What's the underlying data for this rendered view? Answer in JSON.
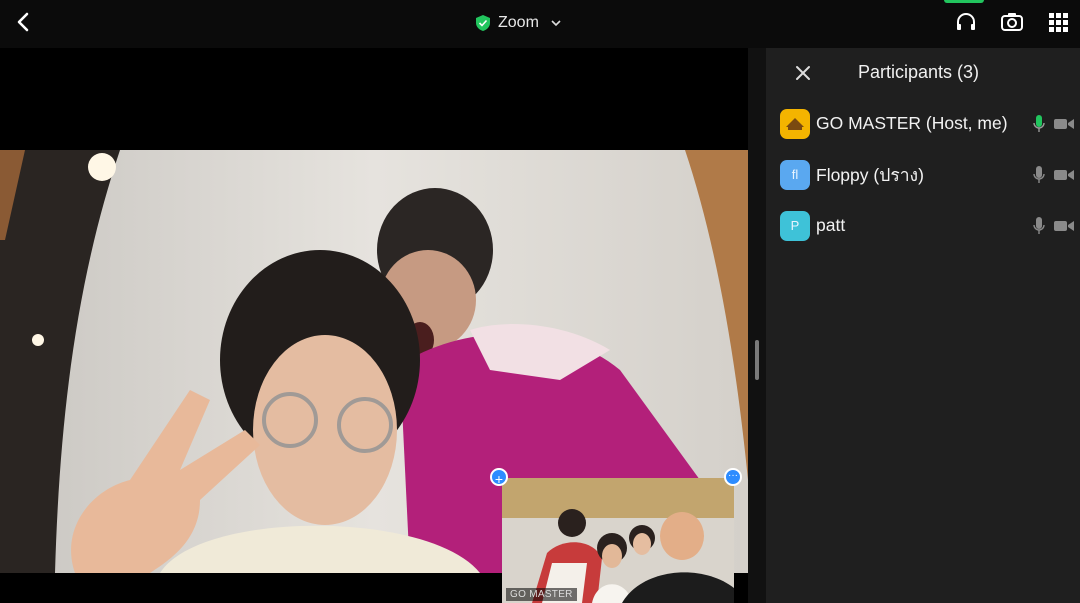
{
  "header": {
    "title": "Zoom",
    "back_icon": "chevron-left-icon",
    "icons": [
      "headphones-icon",
      "camera-switch-icon",
      "grid-icon"
    ]
  },
  "pip": {
    "name": "GO MASTER"
  },
  "participants": {
    "title": "Participants (3)",
    "items": [
      {
        "name": "GO MASTER (Host, me)",
        "initial": "",
        "avatar_color": "#f4b400",
        "mic": "active"
      },
      {
        "name": "Floppy (ปราง)",
        "initial": "fl",
        "avatar_color": "#5aa8f0",
        "mic": "idle"
      },
      {
        "name": "patt",
        "initial": "P",
        "avatar_color": "#3ec2d8",
        "mic": "idle"
      }
    ]
  },
  "colors": {
    "accent": "#2d8cff",
    "secure_green": "#22c55e",
    "mic_active": "#22c55e",
    "panel_bg": "#1f1f1f"
  }
}
